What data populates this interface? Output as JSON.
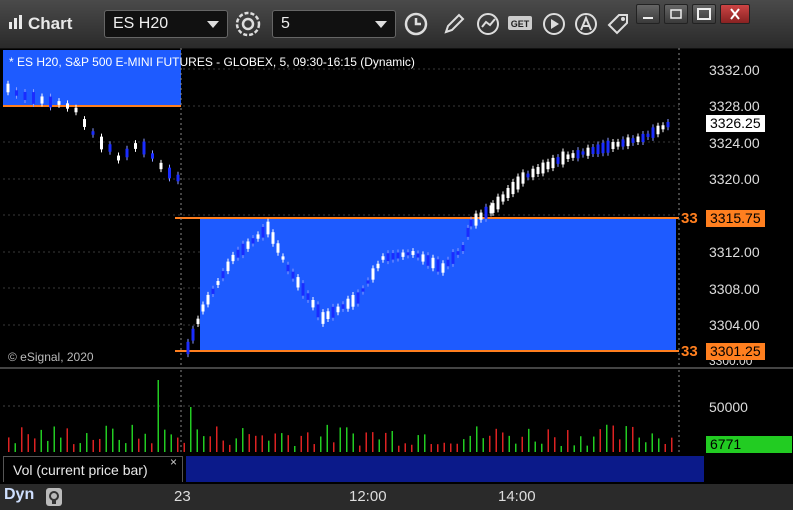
{
  "window": {
    "title": "Chart",
    "symbol": "ES H20",
    "interval": "5"
  },
  "info_line": "* ES H20, S&P 500 E-MINI FUTURES - GLOBEX, 5, 09:30-16:15 (Dynamic)",
  "copyright": "© eSignal, 2020",
  "price_axis": {
    "labels": [
      "3332.00",
      "3328.00",
      "3324.00",
      "3320.00",
      "3316.00",
      "3312.00",
      "3308.00",
      "3304.00",
      "3300.00"
    ],
    "last_price": "3326.25",
    "level_high": "3315.75",
    "level_low": "3301.25",
    "level_marker_high": "33",
    "level_marker_low": "33"
  },
  "volume_axis": {
    "label": "50000",
    "last_volume": "6771"
  },
  "volume_panel": {
    "tab_label": "Vol (current price bar)",
    "close_glyph": "×"
  },
  "time_axis": [
    "23",
    "12:00",
    "14:00"
  ],
  "bottom_bar": {
    "mode_label": "Dyn"
  },
  "colors": {
    "up_candle": "#ffffff",
    "down_candle": "#1a2cff",
    "band": "#1e5bff",
    "level_line": "#ff7f1f",
    "vol_up": "#22cc22",
    "vol_down": "#dd2222",
    "last_badge": "#22cc22"
  },
  "icons": [
    "gear-icon",
    "clock-icon",
    "pencil-icon",
    "chart-icon",
    "get-icon",
    "play-icon",
    "letter-a-icon",
    "tag-icon",
    "minimize-icon",
    "restore-icon",
    "maximize-icon",
    "close-icon"
  ]
}
